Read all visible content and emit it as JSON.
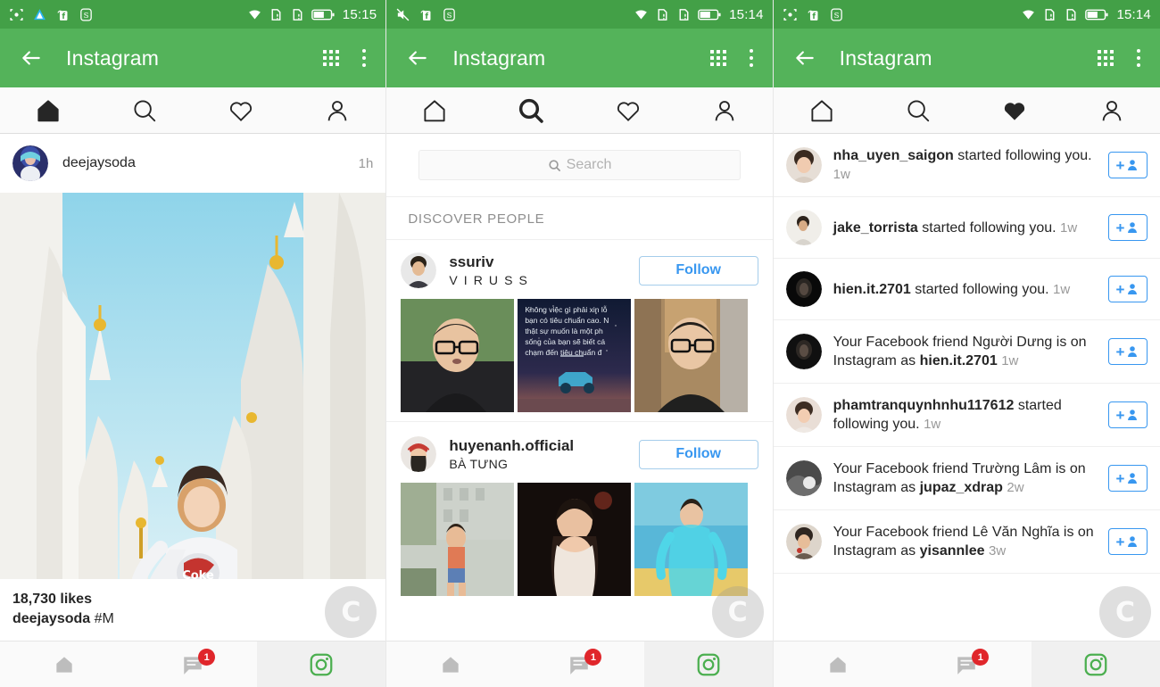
{
  "panels": [
    {
      "status": {
        "time": "15:15",
        "icons": [
          "screenshot-icon",
          "triangle-app-icon",
          "facebook-icon",
          "s-app-icon"
        ],
        "right_icons": [
          "wifi-icon",
          "sim1-icon",
          "sim2-icon",
          "battery-icon"
        ]
      },
      "appbar": {
        "back": "back-arrow-icon",
        "title": "Instagram",
        "grid": "grid-icon",
        "overflow": "more-vertical-icon"
      },
      "tabs": [
        {
          "name": "home",
          "icon": "home-icon",
          "active": true
        },
        {
          "name": "search",
          "icon": "search-icon",
          "active": false
        },
        {
          "name": "activity",
          "icon": "heart-icon",
          "active": false
        },
        {
          "name": "profile",
          "icon": "person-icon",
          "active": false
        }
      ],
      "post": {
        "username": "deejaysoda",
        "time": "1h",
        "likes": "18,730 likes",
        "caption_user": "deejaysoda",
        "caption_text": " #M"
      }
    },
    {
      "status": {
        "time": "15:14",
        "icons": [
          "mute-icon",
          "facebook-icon",
          "s-app-icon"
        ],
        "right_icons": [
          "wifi-icon",
          "sim1-icon",
          "sim2-icon",
          "battery-icon"
        ]
      },
      "appbar": {
        "back": "back-arrow-icon",
        "title": "Instagram",
        "grid": "grid-icon",
        "overflow": "more-vertical-icon"
      },
      "tabs": [
        {
          "name": "home",
          "icon": "home-icon",
          "active": false
        },
        {
          "name": "search",
          "icon": "search-icon",
          "active": true
        },
        {
          "name": "activity",
          "icon": "heart-icon",
          "active": false
        },
        {
          "name": "profile",
          "icon": "person-icon",
          "active": false
        }
      ],
      "search": {
        "placeholder": "Search"
      },
      "section_title": "DISCOVER PEOPLE",
      "people": [
        {
          "username": "ssuriv",
          "fullname": "V I R U S S",
          "follow_label": "Follow",
          "thumb_quote": "Không việc gì phải xin lỗ\nbạn có tiêu chuẩn cao. N\nthật sự muốn là một ph\nsống của bạn sẽ biết cá\nchạm đến tiêu chuẩn đ"
        },
        {
          "username": "huyenanh.official",
          "fullname": "BÀ TƯNG",
          "follow_label": "Follow"
        }
      ]
    },
    {
      "status": {
        "time": "15:14",
        "icons": [
          "screenshot-icon",
          "facebook-icon",
          "s-app-icon"
        ],
        "right_icons": [
          "wifi-icon",
          "sim1-icon",
          "sim2-icon",
          "battery-icon"
        ]
      },
      "appbar": {
        "back": "back-arrow-icon",
        "title": "Instagram",
        "grid": "grid-icon",
        "overflow": "more-vertical-icon"
      },
      "tabs": [
        {
          "name": "home",
          "icon": "home-icon",
          "active": false
        },
        {
          "name": "search",
          "icon": "search-icon",
          "active": false
        },
        {
          "name": "activity",
          "icon": "heart-icon",
          "active": true
        },
        {
          "name": "profile",
          "icon": "person-icon",
          "active": false
        }
      ],
      "activity": [
        {
          "bold_lead": "nha_uyen_saigon",
          "text": " started following you.",
          "ago": "1w",
          "avatar_colors": [
            "#6b5545",
            "#d9b59a"
          ]
        },
        {
          "bold_lead": "jake_torrista",
          "text": " started following you.",
          "ago": "1w",
          "avatar_colors": [
            "#c9c9c9",
            "#8a8a8a"
          ]
        },
        {
          "bold_lead": "hien.it.2701",
          "text": " started following you.",
          "ago": "1w",
          "avatar_colors": [
            "#1a1a1a",
            "#000000"
          ]
        },
        {
          "pre": "Your Facebook friend Người Dưng is on Instagram as ",
          "bold_tail": "hien.it.2701",
          "ago": "1w",
          "avatar_colors": [
            "#232323",
            "#0a0a0a"
          ]
        },
        {
          "bold_lead": "phamtranquynhnhu117612",
          "text": " started following you.",
          "ago": "1w",
          "avatar_colors": [
            "#c4a79a",
            "#e0cfc4"
          ]
        },
        {
          "pre": "Your Facebook friend Trường Lâm is on Instagram as ",
          "bold_tail": "jupaz_xdrap",
          "ago": "2w",
          "avatar_colors": [
            "#4a4a4a",
            "#9e9e9e"
          ]
        },
        {
          "pre": "Your Facebook friend Lê Văn Nghĩa is on Instagram as ",
          "bold_tail": "yisannlee",
          "ago": "3w",
          "avatar_colors": [
            "#6e6058",
            "#b4a396"
          ]
        }
      ]
    }
  ],
  "sysbar": {
    "home": "home-icon",
    "recents": "chat-icon",
    "badge": "1",
    "camera": "instagram-camera-icon"
  },
  "fab": {
    "glyph": "C",
    "name": "screen-recorder-floating-button"
  },
  "colors": {
    "status_green": "#43a047",
    "appbar_green": "#54b35a",
    "link_blue": "#3897f0",
    "badge_red": "#e0262b",
    "ig_green": "#4caf50"
  }
}
